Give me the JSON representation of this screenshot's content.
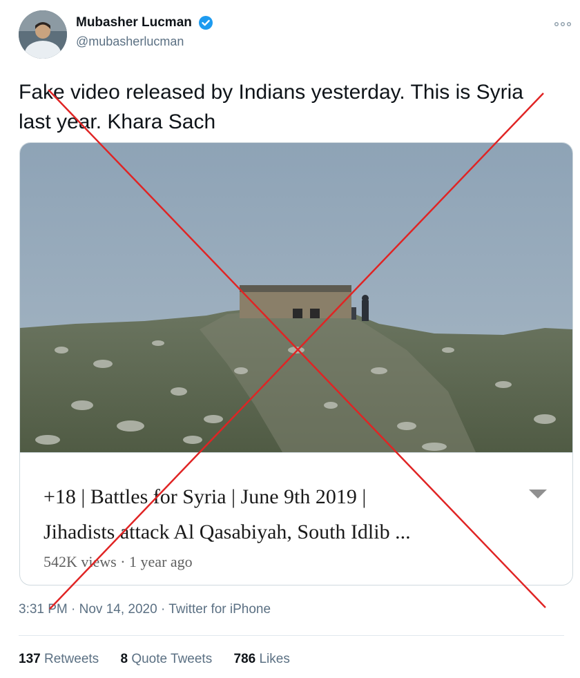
{
  "author": {
    "name": "Mubasher Lucman",
    "handle": "@mubasherlucman",
    "verified": true,
    "avatar_icon": "profile-photo"
  },
  "more_icon": "more-options-icon",
  "tweet": {
    "text": "Fake video released by Indians yesterday. This is Syria\nlast year. Khara Sach"
  },
  "card": {
    "title": "+18 | Battles for Syria | June 9th 2019 |\nJihadists attack Al Qasabiyah, South Idlib ...",
    "meta": "542K views · 1 year ago",
    "caret_icon": "dropdown-caret-icon"
  },
  "timestamp": "3:31 PM · Nov 14, 2020 · Twitter for iPhone",
  "stats": {
    "retweets_count": "137",
    "retweets_label": "Retweets",
    "quotes_count": "8",
    "quotes_label": "Quote Tweets",
    "likes_count": "786",
    "likes_label": "Likes"
  },
  "colors": {
    "verified": "#1d9bf0",
    "secondary_text": "#5b7083",
    "overlay_x": "#e02424"
  }
}
